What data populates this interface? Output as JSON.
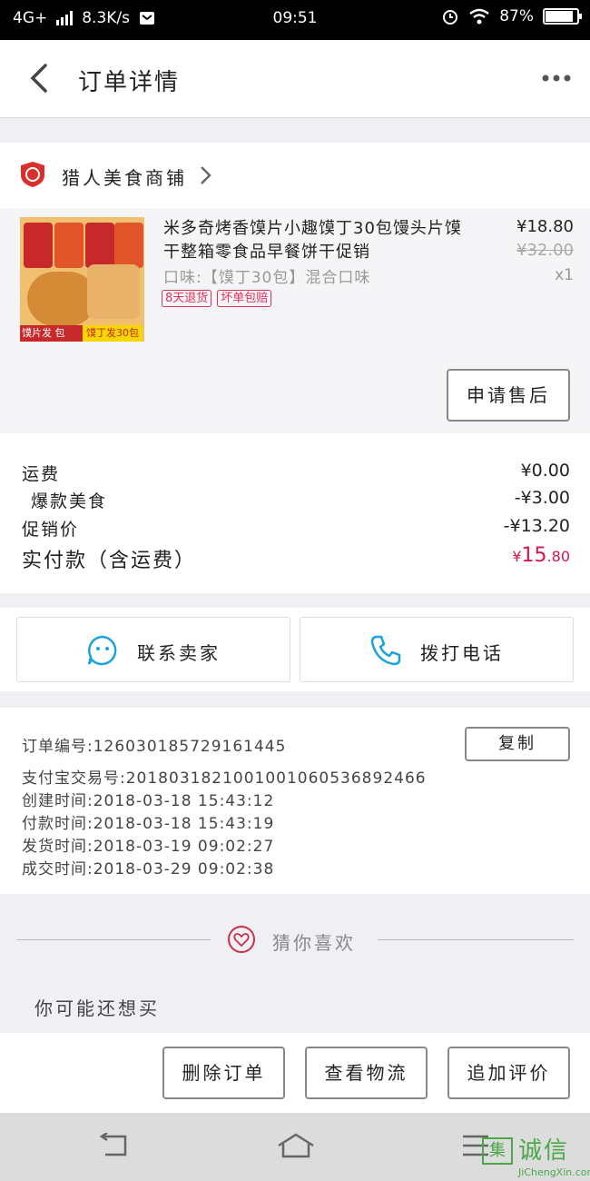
{
  "status": {
    "network": "4G+",
    "speed": "8.3K/s",
    "time": "09:51",
    "battery": "87%",
    "battery_level": 0.87
  },
  "header": {
    "title": "订单详情"
  },
  "shop": {
    "name": "猎人美食商铺"
  },
  "item": {
    "name": "米多奇烤香馍片小趣馍丁30包馒头片馍干整箱零食品早餐饼干促销",
    "spec": "口味:【馍丁30包】混合口味",
    "price": "¥18.80",
    "old_price": "¥32.00",
    "qty": "x1",
    "tags": [
      "8天退货",
      "坏单包赔"
    ],
    "thumb_banner_left": "馍片发  包",
    "thumb_banner_right": "馍丁发30包",
    "after_sale_label": "申请售后"
  },
  "fees": {
    "shipping_label": "运费",
    "shipping_value": "¥0.00",
    "promo_label": "爆款美食",
    "promo_value": "-¥3.00",
    "discount_label": "促销价",
    "discount_value": "-¥13.20",
    "total_label": "实付款（含运费）",
    "total_symbol": "¥",
    "total_int": "15",
    "total_dec": ".80"
  },
  "contact": {
    "seller_label": "联系卖家",
    "call_label": "拨打电话"
  },
  "order": {
    "number_label": "订单编号:",
    "number": "126030185729161445",
    "copy_label": "复制",
    "alipay_label": "支付宝交易号:",
    "alipay": "2018031821001001060536892466",
    "created_label": "创建时间:",
    "created": "2018-03-18 15:43:12",
    "paid_label": "付款时间:",
    "paid": "2018-03-18 15:43:19",
    "shipped_label": "发货时间:",
    "shipped": "2018-03-19 09:02:27",
    "done_label": "成交时间:",
    "done": "2018-03-29 09:02:38"
  },
  "recommend": {
    "guess_label": "猜你喜欢",
    "maybe_label": "你可能还想买"
  },
  "actions": {
    "delete": "删除订单",
    "logistics": "查看物流",
    "review": "追加评价"
  },
  "watermark": {
    "box": "集",
    "text": "诚信",
    "sub": "JiChengXin.com"
  },
  "colors": {
    "accent": "#d8154c",
    "tag": "#e0315b",
    "icon_blue": "#1aa3e0"
  }
}
